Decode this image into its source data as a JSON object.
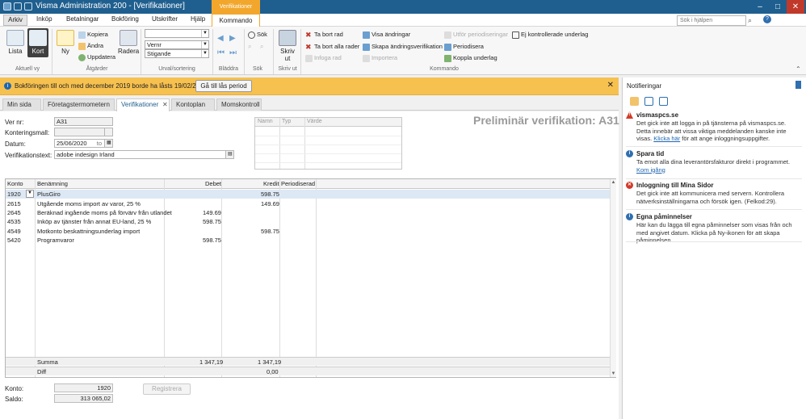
{
  "titlebar": {
    "title": "Visma Administration 200 - [Verifikationer]",
    "context_tab": "Verifikationer"
  },
  "menu": {
    "tabs": [
      "Arkiv",
      "Inköp",
      "Betalningar",
      "Bokföring",
      "Utskrifter",
      "Hjälp",
      "Kommando"
    ],
    "search_placeholder": "Sök i hjälpen"
  },
  "ribbon": {
    "aktuell_vy": {
      "label": "Aktuell vy",
      "lista": "Lista",
      "kort": "Kort"
    },
    "atgarder": {
      "label": "Åtgärder",
      "ny": "Ny",
      "kopiera": "Kopiera",
      "andra": "Ändra",
      "uppdatera": "Uppdatera",
      "radera": "Radera"
    },
    "urval": {
      "label": "Urval/sortering",
      "combo1": "",
      "combo2": "Vernr",
      "combo3": "Stigande"
    },
    "bladdra": {
      "label": "Bläddra"
    },
    "sok": {
      "label": "Sök",
      "btn": "Sök"
    },
    "skrivut": {
      "label": "Skriv ut",
      "btn": "Skriv ut"
    },
    "kommando": {
      "label": "Kommando",
      "ta_bort_rad": "Ta bort rad",
      "ta_bort_alla": "Ta bort alla rader",
      "infoga_rad": "Infoga rad",
      "visa_andringar": "Visa ändringar",
      "skapa_andringsverifikation": "Skapa ändringsverifikation",
      "importera": "Importera",
      "utfor_periodisering": "Utför periodiseringar",
      "periodisera": "Periodisera",
      "koppla_underlag": "Koppla underlag",
      "ej_kontrollerade": "Ej kontrollerade underlag"
    }
  },
  "banner": {
    "text": "Bokföringen till och med december 2019 borde ha låsts 19/02/2020.",
    "button": "Gå till lås period"
  },
  "doc_tabs": [
    "Min sida",
    "Företagstermometern",
    "Verifikationer",
    "Kontoplan",
    "Momskontroll"
  ],
  "form": {
    "vernr_label": "Ver nr:",
    "vernr": "A31",
    "kontmall_label": "Konteringsmall:",
    "datum_label": "Datum:",
    "datum": "25/06/2020",
    "datum_suffix": "to",
    "vtext_label": "Verifikationstext:",
    "vtext": "adobe indesign Irland",
    "preliminar": "Preliminär verifikation: A31"
  },
  "attr_table": {
    "headers": [
      "Namn",
      "Typ",
      "Värde"
    ]
  },
  "grid": {
    "headers": [
      "Konto",
      "Benämning",
      "Debet",
      "Kredit",
      "Periodiserad"
    ],
    "rows": [
      {
        "konto": "1920",
        "ben": "PlusGiro",
        "debet": "",
        "kredit": "598.75"
      },
      {
        "konto": "2615",
        "ben": "Utgående moms import av varor, 25 %",
        "debet": "",
        "kredit": "149.69"
      },
      {
        "konto": "2645",
        "ben": "Beräknad ingående moms på förvärv från utlandet",
        "debet": "149.69",
        "kredit": ""
      },
      {
        "konto": "4535",
        "ben": "Inköp av tjänster från annat EU-land, 25 %",
        "debet": "598.75",
        "kredit": ""
      },
      {
        "konto": "4549",
        "ben": "Motkonto beskattningsunderlag import",
        "debet": "",
        "kredit": "598.75"
      },
      {
        "konto": "5420",
        "ben": "Programvaror",
        "debet": "598.75",
        "kredit": ""
      }
    ],
    "summa_label": "Summa",
    "summa_debet": "1 347,19",
    "summa_kredit": "1 347,19",
    "diff_label": "Diff",
    "diff_kredit": "0,00"
  },
  "bottom": {
    "konto_label": "Konto:",
    "konto": "1920",
    "saldo_label": "Saldo:",
    "saldo": "313 065,02",
    "registrera": "Registrera"
  },
  "notifications": {
    "title": "Notifieringar",
    "items": [
      {
        "type": "warning",
        "title": "vismaspcs.se",
        "body": "Det gick inte att logga in på tjänsterna på vismaspcs.se. Detta innebär att vissa viktiga meddelanden kanske inte visas. ",
        "link": "Klicka här",
        "body2": " för att ange inloggningsuppgifter."
      },
      {
        "type": "info",
        "title": "Spara tid",
        "body": "Ta emot alla dina leverantörsfakturor direkt i programmet. ",
        "link": "Kom igång",
        "body2": ""
      },
      {
        "type": "error",
        "title": "Inloggning till Mina Sidor",
        "body": "Det gick inte att kommunicera med servern. Kontrollera nätverksinställningarna och försök igen. (Felkod:29).",
        "link": "",
        "body2": ""
      },
      {
        "type": "info",
        "title": "Egna påminnelser",
        "body": "Här kan du lägga till egna påminnelser som visas från och med angivet datum. Klicka på Ny-ikonen för att skapa påminnelsen.",
        "link": "",
        "body2": ""
      }
    ]
  }
}
